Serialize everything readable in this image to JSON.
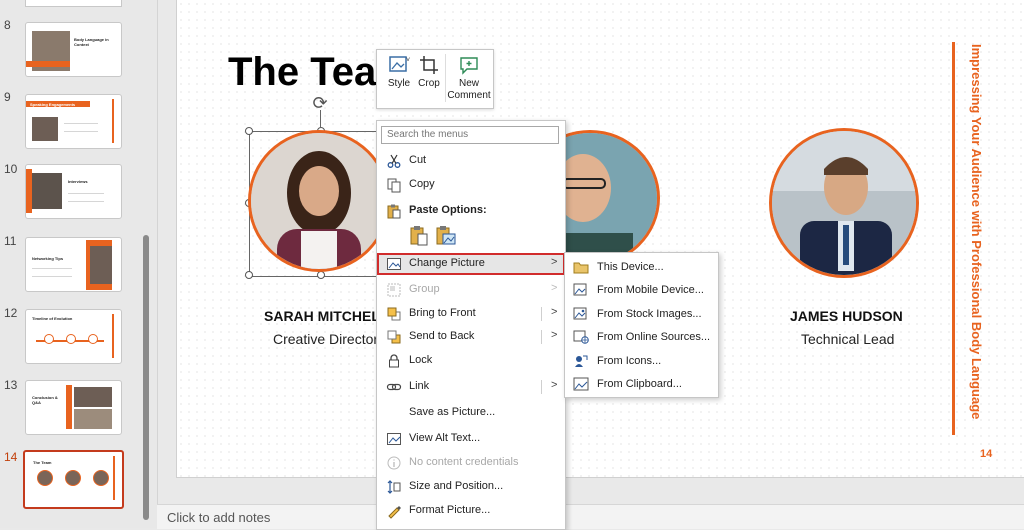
{
  "thumbnails": [
    {
      "number": "8",
      "title": "Body Language in Context"
    },
    {
      "number": "9",
      "title": "Speaking Engagements"
    },
    {
      "number": "10",
      "title": "Interviews"
    },
    {
      "number": "11",
      "title": "Networking Tips"
    },
    {
      "number": "12",
      "title": "Timeline of Evolution"
    },
    {
      "number": "13",
      "title": "Conclusion & Q&A"
    },
    {
      "number": "14",
      "title": "The Team"
    }
  ],
  "slide": {
    "title": "The Tea",
    "side_text": "Impressing Your Audience with Professional Body Language",
    "page_number": "14",
    "people": [
      {
        "name": "SARAH MITCHELL",
        "role": "Creative Director"
      },
      {
        "name": "JAMES HUDSON",
        "role": "Technical Lead"
      }
    ]
  },
  "notes": {
    "placeholder": "Click to add notes"
  },
  "mini_toolbar": {
    "style": "Style",
    "crop": "Crop",
    "new_comment": "New Comment"
  },
  "context_menu": {
    "search_placeholder": "Search the menus",
    "cut": "Cut",
    "copy": "Copy",
    "paste_options": "Paste Options:",
    "change_picture": "Change Picture",
    "group": "Group",
    "bring_to_front": "Bring to Front",
    "send_to_back": "Send to Back",
    "lock": "Lock",
    "link": "Link",
    "save_as_picture": "Save as Picture...",
    "view_alt_text": "View Alt Text...",
    "no_content_credentials": "No content credentials",
    "size_and_position": "Size and Position...",
    "format_picture": "Format Picture..."
  },
  "submenu": {
    "this_device": "This Device...",
    "from_mobile": "From Mobile Device...",
    "from_stock": "From Stock Images...",
    "from_online": "From Online Sources...",
    "from_icons": "From Icons...",
    "from_clipboard": "From Clipboard..."
  },
  "colors": {
    "accent": "#e8631f",
    "highlight_border": "#d12c2c"
  }
}
